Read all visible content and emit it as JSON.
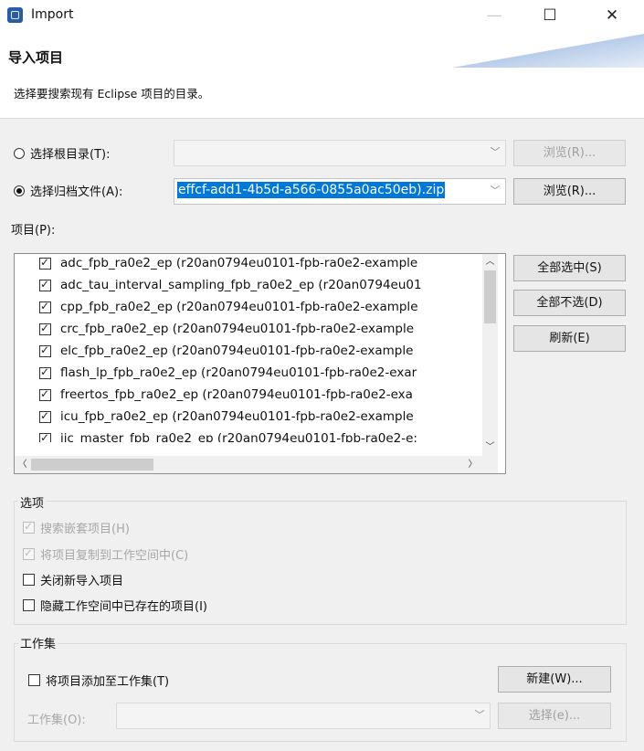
{
  "window": {
    "title": "Import",
    "min_glyph": "—",
    "max_glyph": "☐",
    "close_glyph": "✕"
  },
  "header": {
    "title": "导入项目",
    "subtitle": "选择要搜索现有 Eclipse 项目的目录。"
  },
  "source": {
    "root_dir_label": "选择根目录(T):",
    "root_dir_value": "",
    "root_browse_label": "浏览(R)...",
    "archive_label": "选择归档文件(A):",
    "archive_value": "effcf-add1-4b5d-a566-0855a0ac50eb).zip",
    "archive_browse_label": "浏览(R)...",
    "selected_option": "archive"
  },
  "projects": {
    "label": "项目(P):",
    "items": [
      {
        "name": "adc_fpb_ra0e2_ep",
        "text": "adc_fpb_ra0e2_ep  (r20an0794eu0101-fpb-ra0e2-example",
        "checked": true
      },
      {
        "name": "adc_tau_interval_sampling_fpb_ra0e2_ep",
        "text": "adc_tau_interval_sampling_fpb_ra0e2_ep  (r20an0794eu01",
        "checked": true
      },
      {
        "name": "cpp_fpb_ra0e2_ep",
        "text": "cpp_fpb_ra0e2_ep  (r20an0794eu0101-fpb-ra0e2-example",
        "checked": true
      },
      {
        "name": "crc_fpb_ra0e2_ep",
        "text": "crc_fpb_ra0e2_ep  (r20an0794eu0101-fpb-ra0e2-example",
        "checked": true
      },
      {
        "name": "elc_fpb_ra0e2_ep",
        "text": "elc_fpb_ra0e2_ep  (r20an0794eu0101-fpb-ra0e2-example",
        "checked": true
      },
      {
        "name": "flash_lp_fpb_ra0e2_ep",
        "text": "flash_lp_fpb_ra0e2_ep  (r20an0794eu0101-fpb-ra0e2-exar",
        "checked": true
      },
      {
        "name": "freertos_fpb_ra0e2_ep",
        "text": "freertos_fpb_ra0e2_ep  (r20an0794eu0101-fpb-ra0e2-exa",
        "checked": true
      },
      {
        "name": "icu_fpb_ra0e2_ep",
        "text": "icu_fpb_ra0e2_ep  (r20an0794eu0101-fpb-ra0e2-example",
        "checked": true
      },
      {
        "name": "iic_master_fpb_ra0e2_ep",
        "text": "iic_master_fpb_ra0e2_ep  (r20an0794eu0101-fpb-ra0e2-e:",
        "checked": true
      }
    ],
    "select_all_label": "全部选中(S)",
    "deselect_all_label": "全部不选(D)",
    "refresh_label": "刷新(E)"
  },
  "options": {
    "title": "选项",
    "search_nested": {
      "label": "搜索嵌套项目(H)",
      "checked": true,
      "enabled": false
    },
    "copy_into_workspace": {
      "label": "将项目复制到工作空间中(C)",
      "checked": true,
      "enabled": false
    },
    "close_new_projects": {
      "label": "关闭新导入项目",
      "checked": false,
      "enabled": true
    },
    "hide_existing": {
      "label": "隐藏工作空间中已存在的项目(I)",
      "checked": false,
      "enabled": true
    }
  },
  "working_set": {
    "title": "工作集",
    "add_label": "将项目添加至工作集(T)",
    "add_checked": false,
    "new_label": "新建(W)...",
    "set_label": "工作集(O):",
    "set_value": "",
    "select_label": "选择(e)..."
  }
}
